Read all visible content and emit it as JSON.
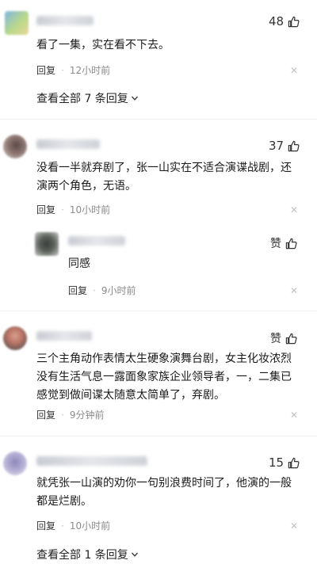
{
  "comments": [
    {
      "likes": "48",
      "text": "看了一集，实在看不下去。",
      "reply_label": "回复",
      "time": "12小时前",
      "see_all": "查看全部 7 条回复"
    },
    {
      "likes": "37",
      "text": "没看一半就弃剧了，张一山实在不适合演谍战剧，还演两个角色，无语。",
      "reply_label": "回复",
      "time": "10小时前",
      "reply": {
        "likes": "赞",
        "text": "同感",
        "reply_label": "回复",
        "time": "9小时前"
      }
    },
    {
      "likes": "赞",
      "text": "三个主角动作表情太生硬象演舞台剧，女主化妆浓烈没有生活气息一露面象家族企业领导者，一，二集已感觉到做间谍太随意太简单了，弃剧。",
      "reply_label": "回复",
      "time": "9分钟前"
    },
    {
      "likes": "15",
      "text": "就凭张一山演的劝你一句别浪费时间了，他演的一般都是烂剧。",
      "reply_label": "回复",
      "time": "10小时前",
      "see_all": "查看全部 1 条回复"
    }
  ],
  "icons": {
    "like": "thumbs-up-icon",
    "close": "close-icon",
    "expand": "chevron-down-icon"
  },
  "colors": {
    "text": "#1a1a1a",
    "meta": "#8a8a8a",
    "close": "#c2c2c2"
  }
}
